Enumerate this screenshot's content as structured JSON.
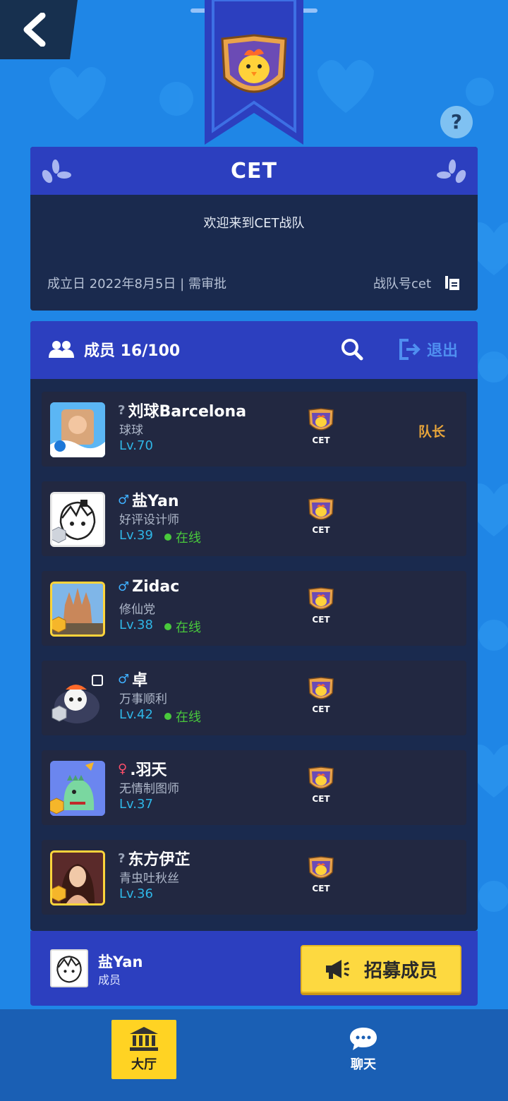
{
  "colors": {
    "background": "#1f86e6",
    "panel": "#1a2a4e",
    "header": "#2c3fbf",
    "row": "#222841",
    "accent_yellow": "#fdd940",
    "level_blue": "#2fb6e6",
    "online_green": "#49c93c",
    "leader_orange": "#e8a53a"
  },
  "team": {
    "name": "CET",
    "welcome": "欢迎来到CET战队",
    "founded": "成立日 2022年8月5日 | 需审批",
    "team_id": "战队号cet"
  },
  "members_header": {
    "label": "成员 16/100",
    "exit_label": "退出"
  },
  "members": [
    {
      "name": "刘球Barcelona",
      "gender": "?",
      "gender_type": "unk",
      "title": "球球",
      "level": "Lv.70",
      "online": "",
      "emblem": "CET",
      "role": "队长"
    },
    {
      "name": "盐Yan",
      "gender": "♂",
      "gender_type": "male",
      "title": "好评设计师",
      "level": "Lv.39",
      "online": "在线",
      "emblem": "CET",
      "role": ""
    },
    {
      "name": "Zidac",
      "gender": "♂",
      "gender_type": "male",
      "title": "修仙党",
      "level": "Lv.38",
      "online": "在线",
      "emblem": "CET",
      "role": ""
    },
    {
      "name": "卓",
      "gender": "♂",
      "gender_type": "male",
      "title": "万事顺利",
      "level": "Lv.42",
      "online": "在线",
      "emblem": "CET",
      "role": ""
    },
    {
      "name": ".羽天",
      "gender": "♀",
      "gender_type": "female",
      "title": "无情制图师",
      "level": "Lv.37",
      "online": "",
      "emblem": "CET",
      "role": ""
    },
    {
      "name": "东方伊芷",
      "gender": "?",
      "gender_type": "unk",
      "title": "青虫吐秋丝",
      "level": "Lv.36",
      "online": "",
      "emblem": "CET",
      "role": ""
    }
  ],
  "self": {
    "name": "盐Yan",
    "role": "成员"
  },
  "recruit_label": "招募成员",
  "nav": {
    "hall": "大厅",
    "chat": "聊天"
  },
  "help_label": "?"
}
